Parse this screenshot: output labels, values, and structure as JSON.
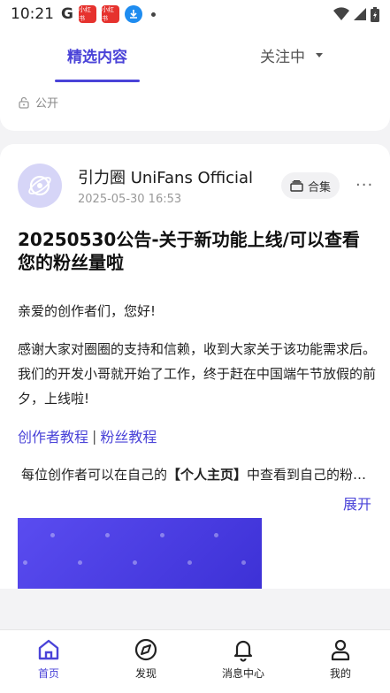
{
  "status_bar": {
    "time": "10:21",
    "google_letter": "G",
    "app_badge_1": "小红书",
    "app_badge_2": "小红书"
  },
  "tabs": {
    "selected": "精选内容",
    "following": "关注中"
  },
  "visibility": "公开",
  "post": {
    "author": "引力圈 UniFans Official",
    "date": "2025-05-30 16:53",
    "collection_label": "合集",
    "more": "···",
    "title": "20250530公告-关于新功能上线/可以查看您的粉丝量啦",
    "greeting": "亲爱的创作者们，您好!",
    "body": "感谢大家对圈圈的支持和信赖，收到大家关于该功能需求后。我们的开发小哥就开始了工作，终于赶在中国端午节放假的前夕，上线啦!",
    "link_creator": "创作者教程",
    "link_separator": "|",
    "link_fans": "粉丝教程",
    "detail_prefix": "每位创作者可以在自己的",
    "detail_bold": "【个人主页】",
    "detail_suffix": "中查看到自己的粉丝量",
    "expand": "展开"
  },
  "bottom_nav": [
    {
      "label": "首页",
      "icon": "home-icon"
    },
    {
      "label": "发现",
      "icon": "compass-icon"
    },
    {
      "label": "消息中心",
      "icon": "bell-icon"
    },
    {
      "label": "我的",
      "icon": "user-icon"
    }
  ],
  "colors": {
    "accent": "#4a43d8",
    "background": "#f3f3f5"
  }
}
